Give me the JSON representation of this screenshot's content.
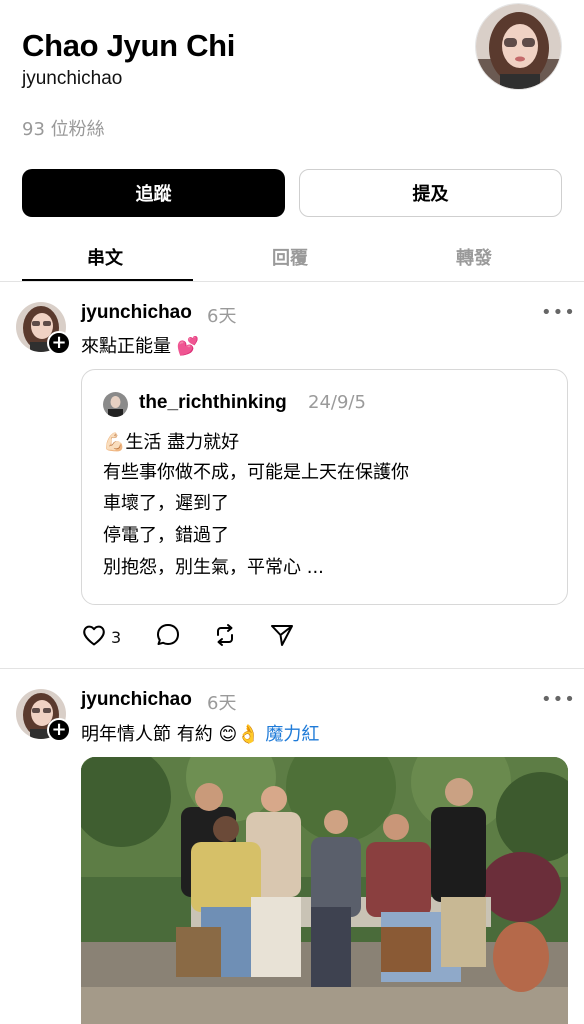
{
  "profile": {
    "display_name": "Chao Jyun Chi",
    "handle": "jyunchichao",
    "followers": "93 位粉絲"
  },
  "buttons": {
    "follow": "追蹤",
    "mention": "提及"
  },
  "tabs": [
    {
      "label": "串文",
      "active": true
    },
    {
      "label": "回覆",
      "active": false
    },
    {
      "label": "轉發",
      "active": false
    }
  ],
  "posts": [
    {
      "user": "jyunchichao",
      "time": "6天",
      "text": "來點正能量 💕",
      "quote": {
        "user": "the_richthinking",
        "date": "24/9/5",
        "lines": [
          "💪🏻生活 盡力就好",
          "有些事你做不成，可能是上天在保護你",
          "車壞了，遲到了",
          "停電了，錯過了",
          "別抱怨，別生氣，平常心 ..."
        ]
      },
      "likes": "3",
      "more": "•••"
    },
    {
      "user": "jyunchichao",
      "time": "6天",
      "text": "明年情人節 有約 😊👌",
      "tag": "魔力紅",
      "more": "•••"
    }
  ],
  "icons": {
    "like": "heart-icon",
    "comment": "comment-icon",
    "repost": "repost-icon",
    "share": "share-icon",
    "more": "more-icon",
    "follow_plus": "plus-icon"
  },
  "colors": {
    "primary": "#000000",
    "muted": "#9a9a9a",
    "link": "#1f7bd8",
    "border": "#e3e3e3"
  }
}
